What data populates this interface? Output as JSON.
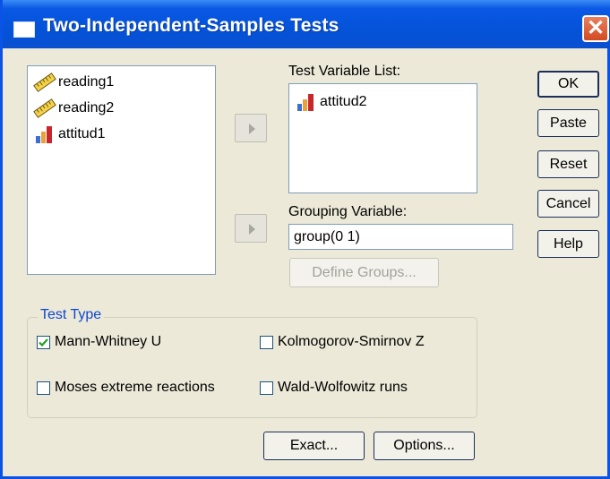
{
  "window": {
    "title": "Two-Independent-Samples Tests",
    "close_glyph": "✕"
  },
  "source_list": [
    {
      "label": "reading1",
      "icon": "ruler-scale-icon"
    },
    {
      "label": "reading2",
      "icon": "ruler-scale-icon"
    },
    {
      "label": "attitud1",
      "icon": "bar-ordinal-icon"
    }
  ],
  "test_variable": {
    "label": "Test Variable List:",
    "items": [
      {
        "label": "attitud2",
        "icon": "bar-ordinal-icon"
      }
    ]
  },
  "grouping": {
    "label": "Grouping Variable:",
    "value": "group(0 1)",
    "define_groups": "Define Groups..."
  },
  "buttons": {
    "ok": "OK",
    "paste": "Paste",
    "reset": "Reset",
    "cancel": "Cancel",
    "help": "Help",
    "exact": "Exact...",
    "options": "Options..."
  },
  "test_type": {
    "legend": "Test Type",
    "options": [
      {
        "label": "Mann-Whitney U",
        "checked": true
      },
      {
        "label": "Kolmogorov-Smirnov Z",
        "checked": false
      },
      {
        "label": "Moses extreme reactions",
        "checked": false
      },
      {
        "label": "Wald-Wolfowitz runs",
        "checked": false
      }
    ]
  },
  "colors": {
    "title_blue": "#0453d9",
    "dialog_bg": "#ece9d8",
    "legend_blue": "#0d47d0",
    "close_red": "#d34a22"
  }
}
